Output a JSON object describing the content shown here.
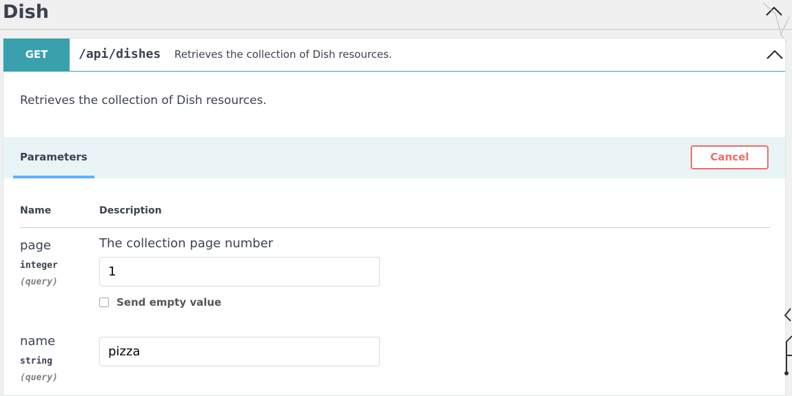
{
  "tag": {
    "title": "Dish"
  },
  "operation": {
    "method": "GET",
    "path": "/api/dishes",
    "summary": "Retrieves the collection of Dish resources.",
    "description": "Retrieves the collection of Dish resources."
  },
  "parameters_section": {
    "tab_label": "Parameters",
    "cancel_label": "Cancel"
  },
  "table": {
    "col_name": "Name",
    "col_description": "Description"
  },
  "params": [
    {
      "name": "page",
      "type": "integer",
      "in": "(query)",
      "description": "The collection page number",
      "value": "1",
      "empty_value_label": "Send empty value"
    },
    {
      "name": "name",
      "type": "string",
      "in": "(query)",
      "value": "pizza"
    }
  ],
  "icons": {
    "tag_toggle": "chevron-up-icon",
    "op_toggle": "chevron-up-icon"
  },
  "colors": {
    "get_method": "#3aa0ad",
    "cancel": "#ef6b67",
    "tab_underline": "#61affe"
  }
}
